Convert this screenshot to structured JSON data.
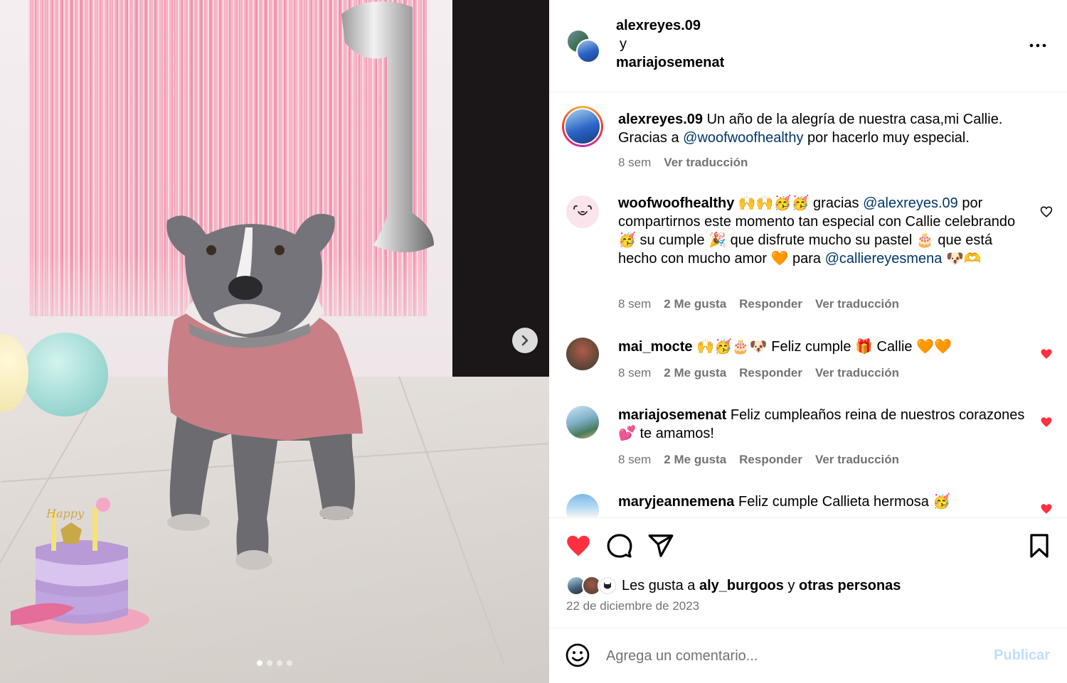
{
  "post": {
    "collaborators": [
      "alexreyes.09",
      "mariajosemenat"
    ],
    "connector": "y",
    "caption": {
      "user": "alexreyes.09",
      "text_before": "Un año de la alegría de nuestra casa,mi Callie. Gracias a",
      "mention": "@woofwoofhealthy",
      "text_after": "por hacerlo muy especial.",
      "time": "8 sem",
      "translate": "Ver traducción"
    },
    "carousel": {
      "slides": 4,
      "current": 1
    }
  },
  "comments": [
    {
      "user": "woofwoofhealthy",
      "parts": [
        {
          "t": " 🙌🙌🥳🥳 gracias "
        },
        {
          "m": "@alexreyes.09"
        },
        {
          "t": " por compartirnos este momento tan especial con Callie celebrando 🥳 su cumple 🎉 que disfrute mucho su pastel 🎂 que está hecho con mucho amor 🧡 para "
        },
        {
          "m": "@calliereyesmena"
        },
        {
          "t": " 🐶🫶"
        }
      ],
      "time": "8 sem",
      "likes": "2 Me gusta",
      "reply": "Responder",
      "translate": "Ver traducción",
      "liked": false
    },
    {
      "user": "mai_mocte",
      "parts": [
        {
          "t": " 🙌🥳🎂🐶 Feliz cumple 🎁 Callie 🧡🧡"
        }
      ],
      "time": "8 sem",
      "likes": "2 Me gusta",
      "reply": "Responder",
      "translate": "Ver traducción",
      "liked": true
    },
    {
      "user": "mariajosemenat",
      "parts": [
        {
          "t": " Feliz cumpleaños reina de nuestros corazones 💕 te amamos!"
        }
      ],
      "time": "8 sem",
      "likes": "2 Me gusta",
      "reply": "Responder",
      "translate": "Ver traducción",
      "liked": true
    },
    {
      "user": "maryjeannemena",
      "parts": [
        {
          "t": " Feliz cumple Callieta hermosa 🥳"
        }
      ],
      "liked": true
    }
  ],
  "likes": {
    "prefix": "Les gusta a",
    "user": "aly_burgoos",
    "connector": "y",
    "others": "otras personas"
  },
  "date": "22 de diciembre de 2023",
  "composer": {
    "placeholder": "Agrega un comentario...",
    "publish": "Publicar"
  },
  "colors": {
    "like_red": "#ff3040",
    "mention": "#00376b",
    "muted": "#737373",
    "publish_disabled": "#c0dffd"
  },
  "icons": [
    "more-icon",
    "chevron-right-icon",
    "heart-icon",
    "comment-icon",
    "share-icon",
    "bookmark-icon",
    "emoji-icon"
  ]
}
